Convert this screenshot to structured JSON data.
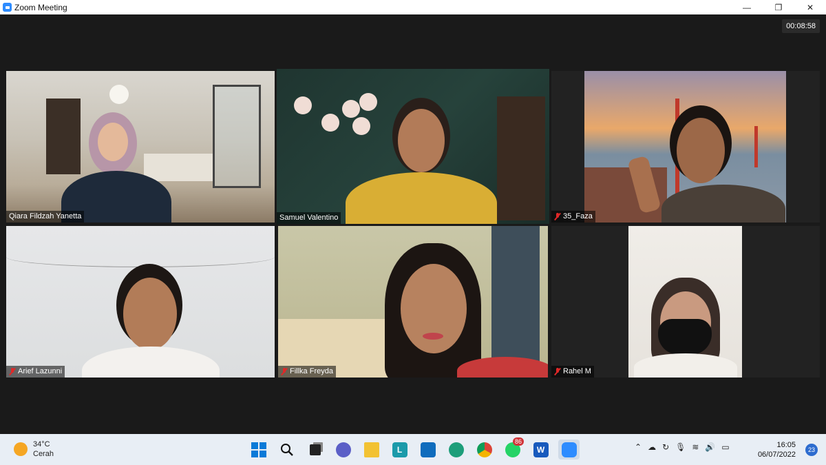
{
  "window": {
    "title": "Zoom Meeting",
    "minimize": "—",
    "restore": "❐",
    "close": "✕"
  },
  "meeting": {
    "timer": "00:08:58",
    "participants": [
      {
        "name": "Qiara Fildzah Yanetta",
        "muted": false
      },
      {
        "name": "Samuel Valentino",
        "muted": false,
        "active_speaker": true
      },
      {
        "name": "35_Faza",
        "muted": true
      },
      {
        "name": "Arief Lazunni",
        "muted": true
      },
      {
        "name": "Fillka Freyda",
        "muted": true
      },
      {
        "name": "Rahel M",
        "muted": true
      }
    ]
  },
  "taskbar": {
    "weather": {
      "temp": "34°C",
      "condition": "Cerah"
    },
    "apps": [
      {
        "icon": "windows-start-icon",
        "label": ""
      },
      {
        "icon": "search-icon",
        "label": ""
      },
      {
        "icon": "task-view-icon",
        "label": ""
      },
      {
        "icon": "chat-icon",
        "label": ""
      },
      {
        "icon": "file-explorer-icon",
        "label": ""
      },
      {
        "icon": "l-app-icon",
        "label": "L"
      },
      {
        "icon": "mail-icon",
        "label": ""
      },
      {
        "icon": "edge-icon",
        "label": ""
      },
      {
        "icon": "chrome-icon",
        "label": ""
      },
      {
        "icon": "whatsapp-icon",
        "label": "",
        "badge": "86"
      },
      {
        "icon": "word-icon",
        "label": "W"
      },
      {
        "icon": "zoom-icon",
        "label": ""
      }
    ],
    "clock": {
      "time": "16:05",
      "date": "06/07/2022"
    },
    "notifications": "23"
  },
  "colors": {
    "active_speaker_border": "#c8e06a",
    "muted_icon": "#e02828",
    "zoom_blue": "#2d8cff"
  }
}
